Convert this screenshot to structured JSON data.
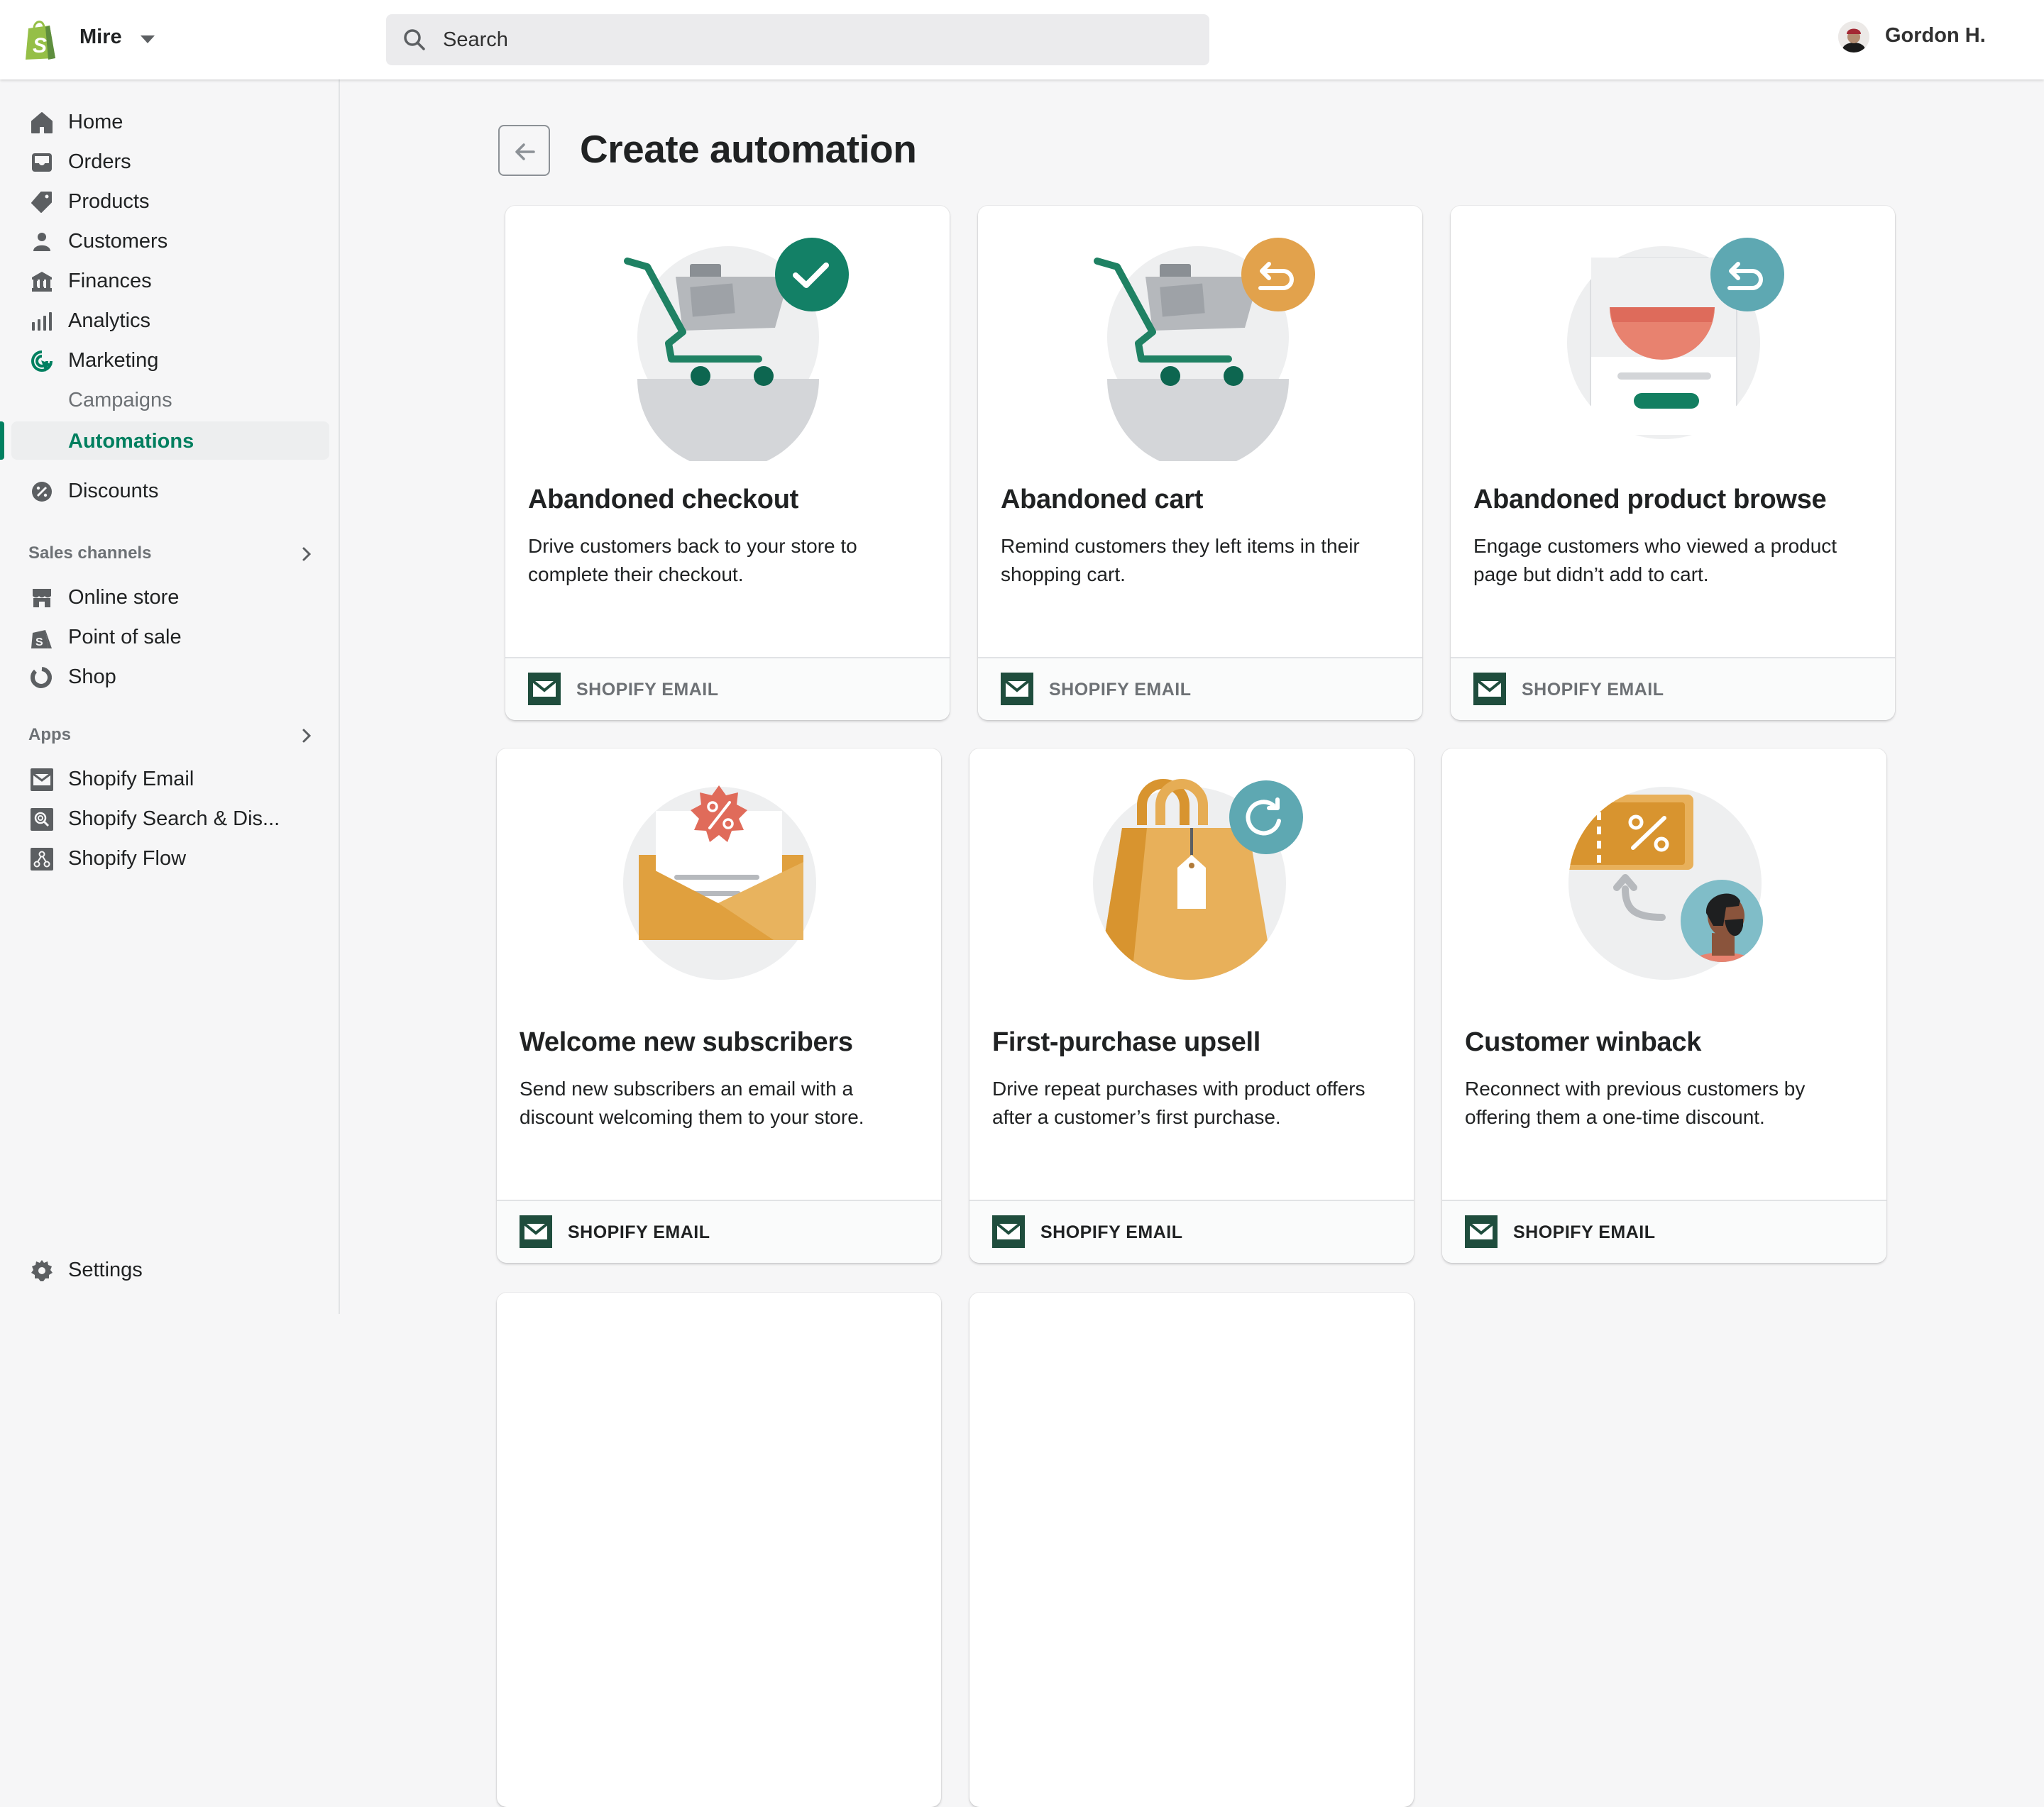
{
  "topbar": {
    "store_name": "Mire",
    "search_placeholder": "Search",
    "user_name": "Gordon H."
  },
  "sidebar": {
    "items": [
      {
        "label": "Home",
        "icon": "home-icon"
      },
      {
        "label": "Orders",
        "icon": "inbox-icon"
      },
      {
        "label": "Products",
        "icon": "tag-icon"
      },
      {
        "label": "Customers",
        "icon": "person-icon"
      },
      {
        "label": "Finances",
        "icon": "bank-icon"
      },
      {
        "label": "Analytics",
        "icon": "bar-chart-icon"
      },
      {
        "label": "Marketing",
        "icon": "target-cursor-icon"
      }
    ],
    "marketing_sub": [
      {
        "label": "Campaigns"
      },
      {
        "label": "Automations",
        "active": true
      }
    ],
    "discounts": {
      "label": "Discounts",
      "icon": "discount-badge-icon"
    },
    "sales_channels": {
      "header": "Sales channels",
      "items": [
        {
          "label": "Online store",
          "icon": "storefront-icon"
        },
        {
          "label": "Point of sale",
          "icon": "pos-bag-icon"
        },
        {
          "label": "Shop",
          "icon": "shop-circle-icon"
        }
      ]
    },
    "apps": {
      "header": "Apps",
      "items": [
        {
          "label": "Shopify Email",
          "icon": "email-app-icon"
        },
        {
          "label": "Shopify Search & Dis...",
          "icon": "search-app-icon"
        },
        {
          "label": "Shopify Flow",
          "icon": "flow-app-icon"
        }
      ]
    },
    "settings": {
      "label": "Settings",
      "icon": "gear-icon"
    }
  },
  "page": {
    "title": "Create automation",
    "back_label": "Back"
  },
  "cards": [
    {
      "title": "Abandoned checkout",
      "description": "Drive customers back to your store to complete their checkout.",
      "app": "SHOPIFY EMAIL",
      "illustration": "cart-check-illustration"
    },
    {
      "title": "Abandoned cart",
      "description": "Remind customers they left items in their shopping cart.",
      "app": "SHOPIFY EMAIL",
      "illustration": "cart-return-illustration"
    },
    {
      "title": "Abandoned product browse",
      "description": "Engage customers who viewed a product page but didn’t add to cart.",
      "app": "SHOPIFY EMAIL",
      "illustration": "product-page-return-illustration"
    },
    {
      "title": "Welcome new subscribers",
      "description": "Send new subscribers an email with a discount welcoming them to your store.",
      "app": "SHOPIFY EMAIL",
      "illustration": "envelope-discount-illustration"
    },
    {
      "title": "First-purchase upsell",
      "description": "Drive repeat purchases with product offers after a customer’s first purchase.",
      "app": "SHOPIFY EMAIL",
      "illustration": "shopping-bag-repeat-illustration"
    },
    {
      "title": "Customer winback",
      "description": "Reconnect with previous customers by offering them a one-time discount.",
      "app": "SHOPIFY EMAIL",
      "illustration": "coupon-customer-illustration"
    }
  ],
  "colors": {
    "brand_green": "#008060",
    "shopify_logo_green": "#95bf47",
    "email_icon": "#1f4d3d",
    "orange": "#e3a34a",
    "teal": "#5fa8b2",
    "coral": "#e0705d"
  }
}
